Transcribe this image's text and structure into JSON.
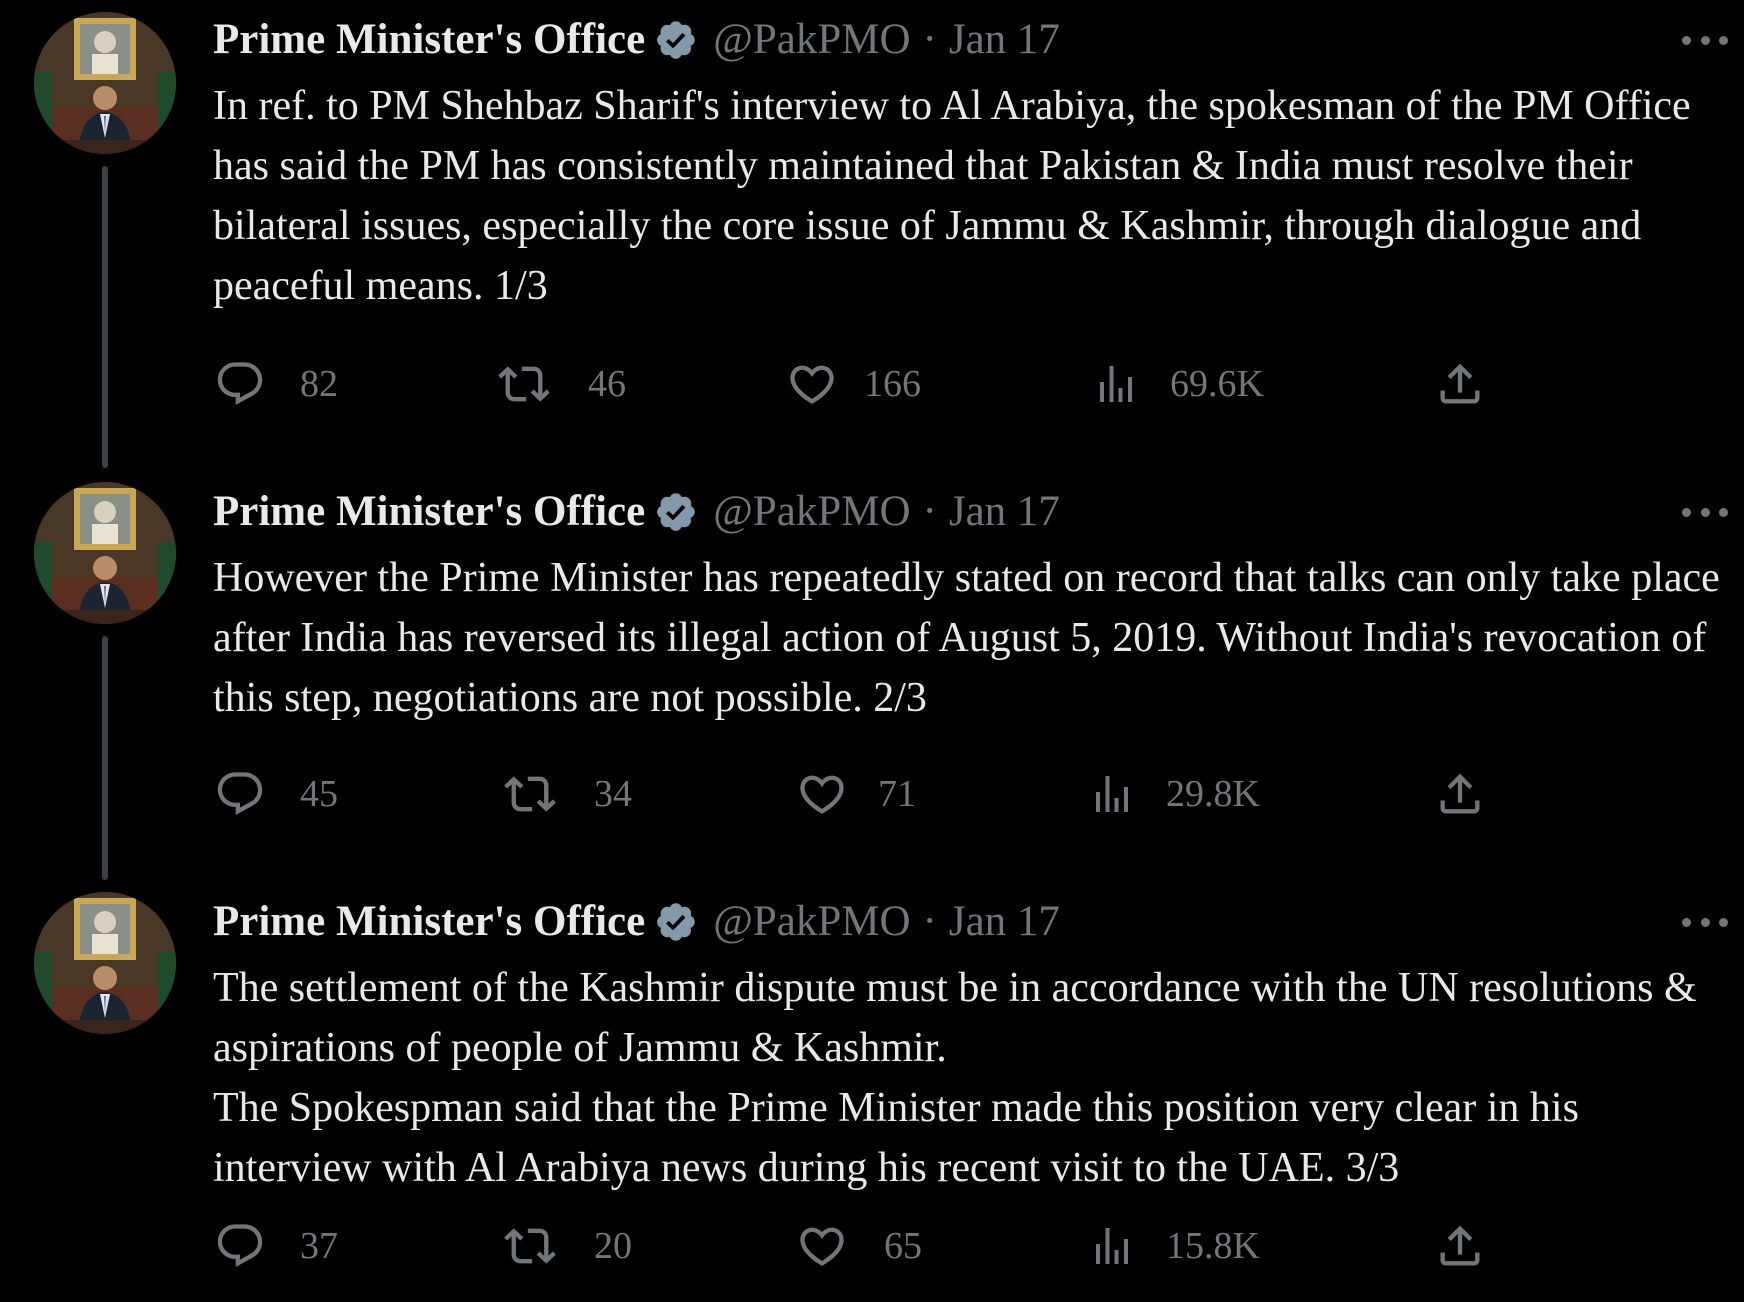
{
  "tweets": [
    {
      "name": "Prime Minister's Office",
      "handle": "@PakPMO",
      "separator": "·",
      "date": "Jan 17",
      "text": [
        "In ref. to PM Shehbaz Sharif's interview to Al Arabiya, the spokesman of the PM Office has said the PM has consistently maintained that Pakistan & India must resolve their bilateral issues, especially the core issue of Jammu & Kashmir, through dialogue and peaceful means. 1/3"
      ],
      "replies": "82",
      "retweets": "46",
      "likes": "166",
      "views": "69.6K"
    },
    {
      "name": "Prime Minister's Office",
      "handle": "@PakPMO",
      "separator": "·",
      "date": "Jan 17",
      "text": [
        "However the Prime Minister has repeatedly stated on record that talks can only take place after India has reversed its illegal action of August 5, 2019. Without India's revocation of this step, negotiations are not possible. 2/3"
      ],
      "replies": "45",
      "retweets": "34",
      "likes": "71",
      "views": "29.8K"
    },
    {
      "name": "Prime Minister's Office",
      "handle": "@PakPMO",
      "separator": "·",
      "date": "Jan 17",
      "text": [
        "The settlement of the Kashmir dispute must be in accordance with the UN resolutions & aspirations of people of Jammu & Kashmir.",
        "The Spokespman said that the Prime Minister made this position very clear in his interview with Al Arabiya news during his recent visit to the UAE. 3/3"
      ],
      "replies": "37",
      "retweets": "20",
      "likes": "65",
      "views": "15.8K"
    }
  ],
  "icons": {
    "verified": "verified-badge-icon",
    "more": "more-options-icon",
    "reply": "reply-icon",
    "retweet": "retweet-icon",
    "like": "like-icon",
    "views": "views-icon",
    "share": "share-icon"
  },
  "colors": {
    "background": "#000000",
    "primary_text": "#e7e9ea",
    "secondary_text": "#71767b",
    "verified_badge": "#829aab",
    "thread_line": "#3e4144"
  }
}
